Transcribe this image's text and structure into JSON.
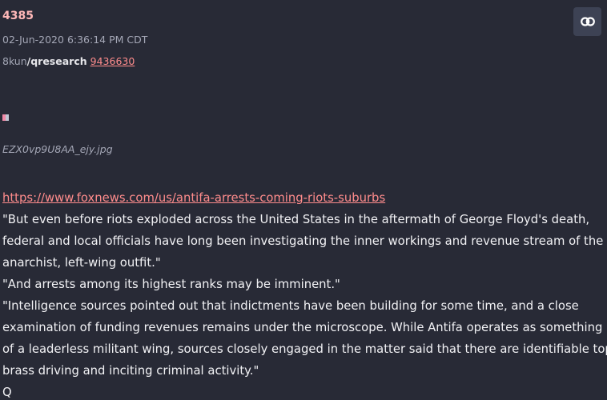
{
  "post": {
    "number": "4385",
    "date": "02-Jun-2020 6:36:14 PM CDT",
    "site": "8kun",
    "board": "/qresearch",
    "ref_id": "9436630",
    "link_icon": "link-icon",
    "attachment": {
      "filename": "EZX0vp9U8AA_ejy.jpg"
    },
    "url": "https://www.foxnews.com/us/antifa-arrests-coming-riots-suburbs",
    "body_lines": [
      "\"But even before riots exploded across the United States in the aftermath of George Floyd's death,",
      "federal and local officials have long been investigating the inner workings and revenue stream of the",
      "anarchist, left-wing outfit.\"",
      "\"And arrests among its highest ranks may be imminent.\"",
      "\"Intelligence sources pointed out that indictments have been building for some time, and a close",
      "examination of funding revenues remains under the microscope. While Antifa operates as something",
      "of a leaderless militant wing, sources closely engaged in the matter said that there are identifiable top",
      "brass driving and inciting criminal activity.\"",
      "Q"
    ]
  },
  "colors": {
    "background": "#282a36",
    "accent": "#ff8c8c",
    "post_number": "#ffb8b8",
    "meta_text": "#a4a7b6",
    "body_text": "#f2f2f5",
    "button_bg": "#3d4254"
  }
}
